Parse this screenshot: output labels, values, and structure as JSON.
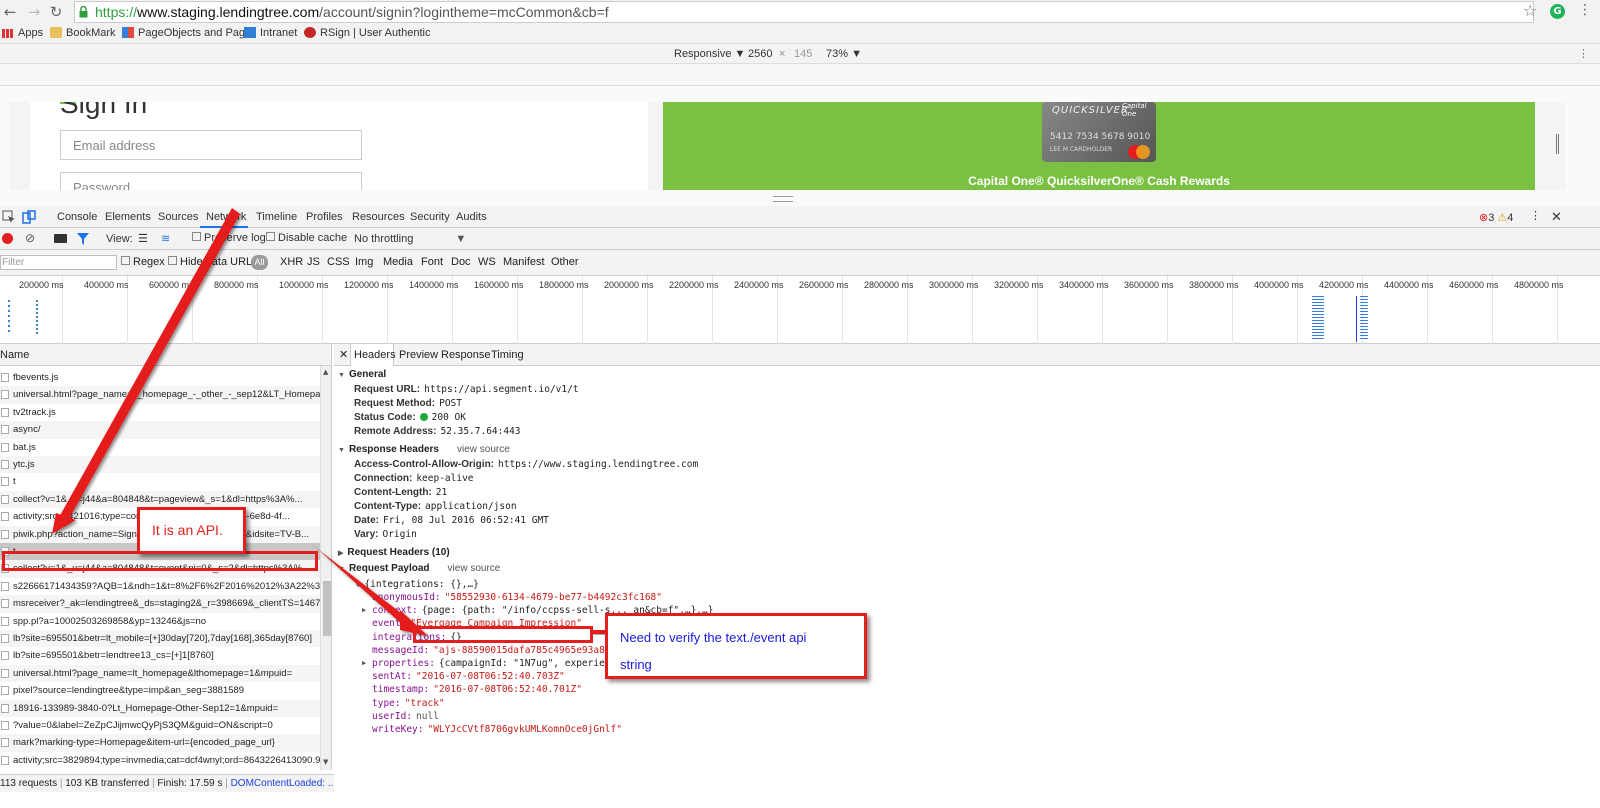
{
  "browser": {
    "url_scheme": "https://",
    "url_host": "www.staging.lendingtree.com",
    "url_path": "/account/signin?logintheme=mcCommon&cb=f",
    "bookmarks": [
      "Apps",
      "BookMark",
      "PageObjects and Pag",
      "Intranet",
      "RSign | User Authentic"
    ]
  },
  "device_toolbar": {
    "mode": "Responsive",
    "width": "2560",
    "height": "145",
    "zoom": "73%"
  },
  "page": {
    "signin_title": "Sign In",
    "email_placeholder": "Email address",
    "password_placeholder": "Password",
    "card_brand": "QUICKSILVER",
    "card_issuer": "Capital One",
    "card_number": "5412  7534  5678  9010",
    "card_holder": "LEE M CARDHOLDER",
    "promo_text": "Capital One® QuicksilverOne® Cash Rewards"
  },
  "devtools": {
    "tabs": [
      "Console",
      "Elements",
      "Sources",
      "Network",
      "Timeline",
      "Profiles",
      "Resources",
      "Security",
      "Audits"
    ],
    "active_tab": "Network",
    "error_count": "3",
    "warning_count": "4",
    "net_toolbar": {
      "view_label": "View:",
      "preserve_log": "Preserve log",
      "disable_cache": "Disable cache",
      "throttling": "No throttling"
    },
    "filter": {
      "placeholder": "Filter",
      "regex": "Regex",
      "hide_data_urls": "Hide data URLs",
      "types": [
        "All",
        "XHR",
        "JS",
        "CSS",
        "Img",
        "Media",
        "Font",
        "Doc",
        "WS",
        "Manifest",
        "Other"
      ]
    },
    "timeline_ticks": [
      "200000 ms",
      "400000 ms",
      "600000 ms",
      "800000 ms",
      "1000000 ms",
      "1200000 ms",
      "1400000 ms",
      "1600000 ms",
      "1800000 ms",
      "2000000 ms",
      "2200000 ms",
      "2400000 ms",
      "2600000 ms",
      "2800000 ms",
      "3000000 ms",
      "3200000 ms",
      "3400000 ms",
      "3600000 ms",
      "3800000 ms",
      "4000000 ms",
      "4200000 ms",
      "4400000 ms",
      "4600000 ms",
      "4800000 ms"
    ],
    "name_header": "Name",
    "requests": [
      "fbevents.js",
      "universal.html?page_name=lt_homepage_-_other_-_sep12&LT_Homepage-...",
      "tv2track.js",
      "async/",
      "bat.js",
      "ytc.js",
      "t",
      "collect?v=1&_v=j44&a=804848&t=pageview&_s=1&dl=https%3A%...",
      "activity;src=4421016;type=conv;cat=lendt0;ord=741b14-6e8d-4f...",
      "piwik.php?action_name=SignIn&idsite=1&rec=1&r=free&idsite=TV-B...",
      "t",
      "collect?v=1&_v=j44&a=804848&t=event&ni=0&_s=2&dl=https%3A%...",
      "s22666171434359?AQB=1&ndh=1&t=8%2F6%2F2016%2012%3A22%3A40...",
      "msreceiver?_ak=lendingtree&_ds=staging2&_r=398669&_clientTS=146796...",
      "spp.pl?a=10002503269858&yp=13246&js=no",
      "lb?site=695501&betr=lt_mobile=[+]30day[720],7day[168],365day[8760]",
      "lb?site=695501&betr=lendtree13_cs=[+]1[8760]",
      "universal.html?page_name=lt_homepage&lthomepage=1&mpuid=",
      "pixel?source=lendingtree&type=imp&an_seg=3881589",
      "18916-133989-3840-0?Lt_Homepage-Other-Sep12=1&mpuid=",
      "?value=0&label=ZeZpCJijmwcQyPjS3QM&guid=ON&script=0",
      "mark?marking-type=Homepage&item-url={encoded_page_url}",
      "activity;src=3829894;type=invmedia;cat=dcf4wnyl;ord=8643226413090.923"
    ],
    "selected_request_index": 10,
    "status": {
      "requests": "113 requests",
      "transferred": "103 KB transferred",
      "finish": "Finish: 17.59 s",
      "dom": "DOMContentLoaded: ..."
    },
    "detail_tabs": [
      "Headers",
      "Preview",
      "Response",
      "Timing"
    ],
    "general": {
      "title": "General",
      "rows": [
        {
          "k": "Request URL:",
          "v": "https://api.segment.io/v1/t"
        },
        {
          "k": "Request Method:",
          "v": "POST"
        },
        {
          "k": "Status Code:",
          "v": "200 OK"
        },
        {
          "k": "Remote Address:",
          "v": "52.35.7.64:443"
        }
      ]
    },
    "response_headers": {
      "title": "Response Headers",
      "view_source": "view source",
      "rows": [
        {
          "k": "Access-Control-Allow-Origin:",
          "v": "https://www.staging.lendingtree.com"
        },
        {
          "k": "Connection:",
          "v": "keep-alive"
        },
        {
          "k": "Content-Length:",
          "v": "21"
        },
        {
          "k": "Content-Type:",
          "v": "application/json"
        },
        {
          "k": "Date:",
          "v": "Fri, 08 Jul 2016 06:52:41 GMT"
        },
        {
          "k": "Vary:",
          "v": "Origin"
        }
      ]
    },
    "request_headers": {
      "title": "Request Headers (10)"
    },
    "payload": {
      "title": "Request Payload",
      "view_source": "view source",
      "root": "{integrations: {},…}",
      "rows": [
        {
          "k": "anonymousId:",
          "v": "\"58552930-6134-4679-be77-b4492c3fc168\"",
          "t": "str"
        },
        {
          "k": "context:",
          "v": "{page: {path: \"/info/ccpss-sell-s...                      an&cb=f\",…},…}",
          "t": "obj"
        },
        {
          "k": "event:",
          "v": "\"Evergage Campaign Impression\"",
          "t": "str"
        },
        {
          "k": "integrations:",
          "v": "{}",
          "t": "obj"
        },
        {
          "k": "messageId:",
          "v": "\"ajs-88590015dafa785c4965e93a8a...\"",
          "t": "str"
        },
        {
          "k": "properties:",
          "v": "{campaignId: \"1N7ug\", experience...",
          "t": "obj"
        },
        {
          "k": "sentAt:",
          "v": "\"2016-07-08T06:52:40.703Z\"",
          "t": "str"
        },
        {
          "k": "timestamp:",
          "v": "\"2016-07-08T06:52:40.701Z\"",
          "t": "str"
        },
        {
          "k": "type:",
          "v": "\"track\"",
          "t": "str"
        },
        {
          "k": "userId:",
          "v": "null",
          "t": "null"
        },
        {
          "k": "writeKey:",
          "v": "\"WLYJcCVtf8706gvkUMLKomnOce0jGnlf\"",
          "t": "str"
        }
      ]
    }
  },
  "annotations": {
    "callout_api": "It is an API.",
    "callout_verify_line1": "Need to verify the text./event api",
    "callout_verify_line2": "string"
  },
  "colors": {
    "annotation_red": "#e41e1e",
    "promo_green": "#7ac142",
    "selected_row": "#c7c7c7"
  }
}
